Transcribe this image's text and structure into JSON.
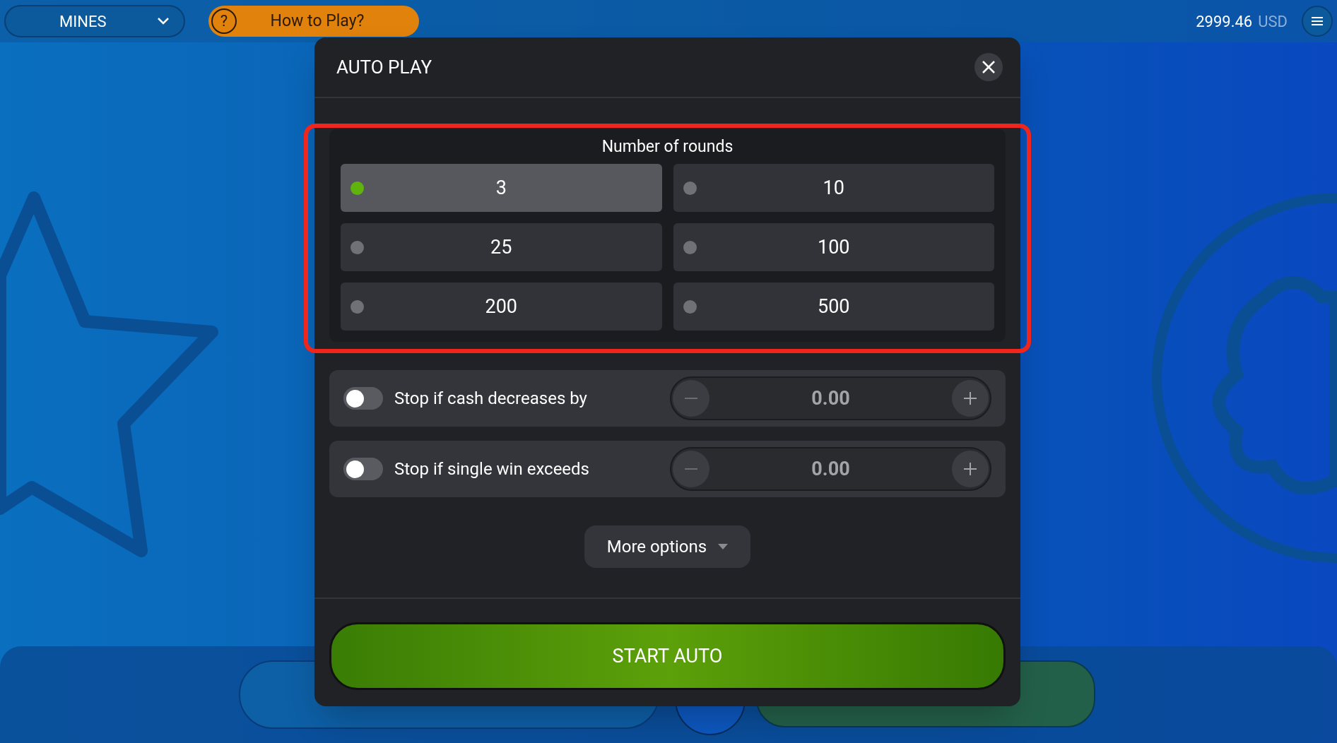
{
  "top_bar": {
    "game_selector": "MINES",
    "help_button": "How to Play?",
    "help_icon": "?",
    "balance": "2999.46",
    "currency": "USD"
  },
  "dialog": {
    "title": "AUTO PLAY",
    "rounds": {
      "label": "Number of rounds",
      "options": [
        {
          "value": "3",
          "selected": true
        },
        {
          "value": "10",
          "selected": false
        },
        {
          "value": "25",
          "selected": false
        },
        {
          "value": "100",
          "selected": false
        },
        {
          "value": "200",
          "selected": false
        },
        {
          "value": "500",
          "selected": false
        }
      ]
    },
    "stop_conditions": [
      {
        "label": "Stop if cash decreases by",
        "on": false,
        "value": "0.00"
      },
      {
        "label": "Stop if single win exceeds",
        "on": false,
        "value": "0.00"
      }
    ],
    "more_options": "More options",
    "start_button": "START AUTO"
  }
}
